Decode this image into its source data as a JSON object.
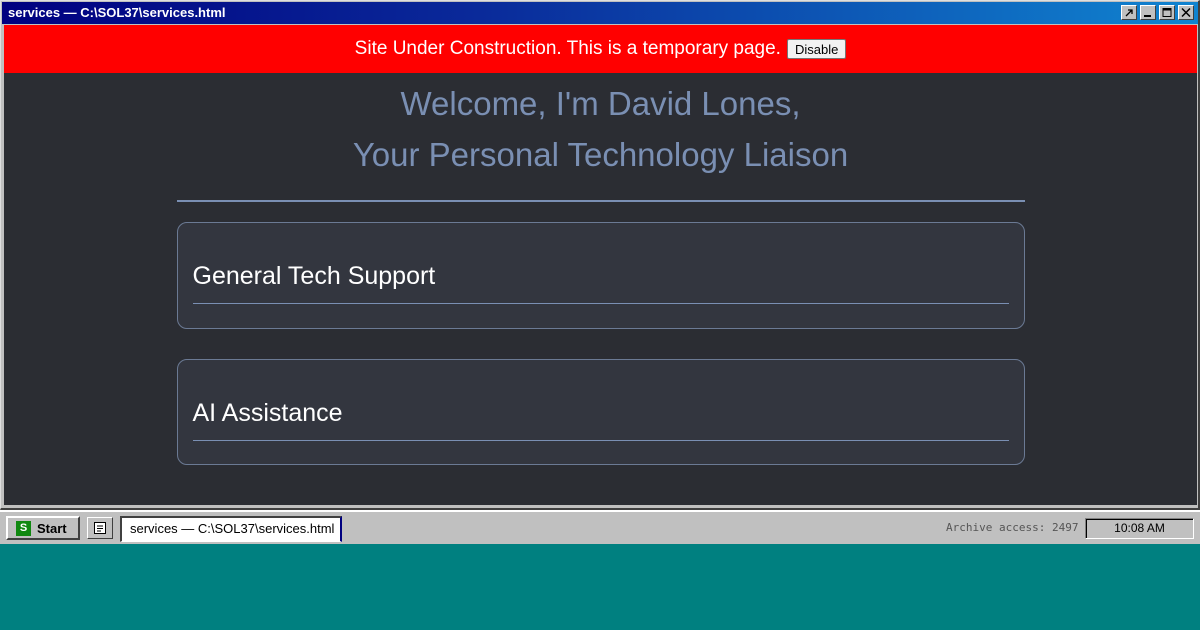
{
  "window": {
    "title": "services — C:\\SOL37\\services.html",
    "buttons": [
      "restore-arrow-icon",
      "minimize-icon",
      "maximize-icon",
      "close-icon"
    ]
  },
  "banner": {
    "message": "Site Under Construction. This is a temporary page.",
    "button_label": "Disable",
    "color": "#ff0000"
  },
  "hero": {
    "line1": "Welcome, I'm David Lones,",
    "line2": "Your Personal Technology Liaison"
  },
  "cards": [
    {
      "title": "General Tech Support"
    },
    {
      "title": "AI Assistance"
    }
  ],
  "taskbar": {
    "start_label": "Start",
    "start_logo": "S",
    "task_label": "services — C:\\SOL37\\services.html",
    "archive_text": "Archive access: 2497",
    "clock": "10:08 AM"
  },
  "colors": {
    "desktop": "#008080",
    "titlebar": "#000080",
    "page_background": "#2b2d33",
    "accent": "#7a8fb3"
  }
}
